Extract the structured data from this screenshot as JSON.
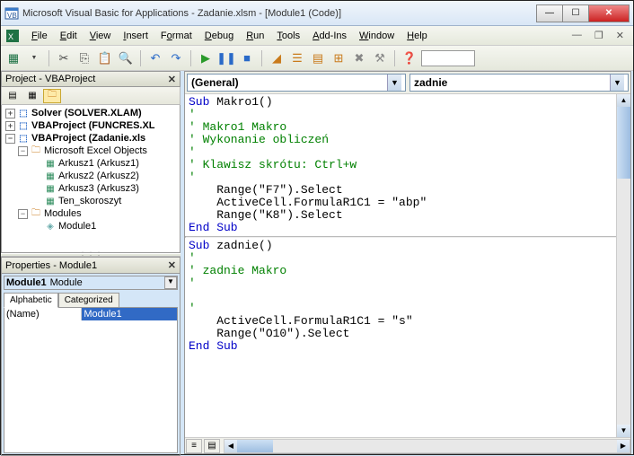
{
  "title": "Microsoft Visual Basic for Applications - Zadanie.xlsm - [Module1 (Code)]",
  "menu": {
    "file": "File",
    "edit": "Edit",
    "view": "View",
    "insert": "Insert",
    "format": "Format",
    "debug": "Debug",
    "run": "Run",
    "tools": "Tools",
    "addins": "Add-Ins",
    "window": "Window",
    "help": "Help"
  },
  "project_pane": {
    "title": "Project - VBAProject",
    "items": {
      "solver": "Solver (SOLVER.XLAM)",
      "funcres": "VBAProject (FUNCRES.XL",
      "zadanie": "VBAProject (Zadanie.xls",
      "excel_objects": "Microsoft Excel Objects",
      "ark1": "Arkusz1 (Arkusz1)",
      "ark2": "Arkusz2 (Arkusz2)",
      "ark3": "Arkusz3 (Arkusz3)",
      "thiswb": "Ten_skoroszyt",
      "modules": "Modules",
      "module1": "Module1"
    }
  },
  "properties_pane": {
    "title": "Properties - Module1",
    "obj_name": "Module1",
    "obj_type": "Module",
    "tab_alpha": "Alphabetic",
    "tab_cat": "Categorized",
    "row_name": "(Name)",
    "row_val": "Module1"
  },
  "code": {
    "combo_left": "(General)",
    "combo_right": "zadnie",
    "l1_kw": "Sub",
    "l1_rest": " Makro1()",
    "l2": "'",
    "l3": "' Makro1 Makro",
    "l4": "' Wykonanie obliczeń",
    "l5": "'",
    "l6": "' Klawisz skrótu: Ctrl+w",
    "l7": "'",
    "l8": "    Range(\"F7\").Select",
    "l9": "    ActiveCell.FormulaR1C1 = \"abp\"",
    "l10": "    Range(\"K8\").Select",
    "l11": "End Sub",
    "l12_kw": "Sub",
    "l12_rest": " zadnie()",
    "l13": "'",
    "l14": "' zadnie Makro",
    "l15": "'",
    "l16": "",
    "l17": "'",
    "l18": "    ActiveCell.FormulaR1C1 = \"s\"",
    "l19": "    Range(\"O10\").Select",
    "l20": "End Sub"
  }
}
